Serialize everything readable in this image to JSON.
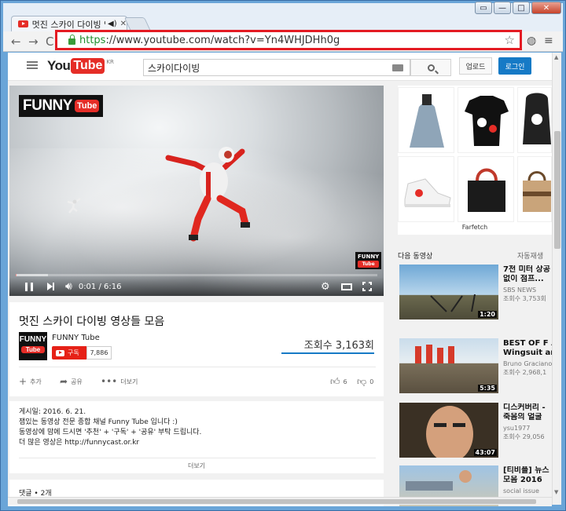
{
  "browser": {
    "tab_title": "멋진 스카이 다이빙 영",
    "url_https": "https",
    "url_rest": "://www.youtube.com/watch?v=Yn4WHJDHh0g"
  },
  "masthead": {
    "logo_you": "You",
    "logo_tube": "Tube",
    "logo_region": "KR",
    "search_value": "스카이다이빙",
    "upload_label": "업로드",
    "login_label": "로그인"
  },
  "player": {
    "badge_funny": "FUNNY",
    "badge_tube": "Tube",
    "watermark_funny": "FUNNY",
    "watermark_tube": "Tube",
    "time": "0:01 / 6:16",
    "progress": 0.003,
    "buffered": 0.09
  },
  "video": {
    "title": "멋진 스카이 다이빙 영상들 모음",
    "channel_name": "FUNNY Tube",
    "channel_logo_funny": "FUNNY",
    "channel_logo_tube": "Tube",
    "subscribe_label": "구독",
    "subscriber_count": "7,886",
    "views": "조회수 3,163회",
    "add_label": "추가",
    "share_label": "공유",
    "more_label": "더보기",
    "likes": "6",
    "dislikes": "0"
  },
  "description": {
    "published": "게시일: 2016. 6. 21.",
    "line1": "잼있는 동영상 전문 종합 채널 Funny Tube 입니다 :)",
    "line2": "동영상에 맘에 드시면 '추천' + '구독' + '공유' 부탁 드립니다.",
    "line3": "더 많은 영상은 http://funnycast.or.kr",
    "more": "더보기"
  },
  "comments": {
    "label": "댓글 • 2개"
  },
  "sidebar": {
    "ad_brand": "Farfetch",
    "up_next": "다음 동영상",
    "autoplay": "자동재생",
    "items": [
      {
        "title1": "7천 미터 상공",
        "title2": "없이 점프...",
        "channel": "SBS NEWS",
        "views": "조회수 3,753회",
        "duration": "1:20"
      },
      {
        "title1": "BEST OF F A",
        "title2": "Wingsuit and",
        "channel": "Bruno Graciano",
        "views": "조회수 2,968,1",
        "duration": "5:35"
      },
      {
        "title1": "디스커버리 -",
        "title2": "죽음의 얼굴",
        "channel": "ysu1977",
        "views": "조회수 29,056",
        "duration": "43:07"
      },
      {
        "title1": "[티비플] 뉴스",
        "title2": "모음 2016",
        "channel": "social issue",
        "views": "",
        "duration": ""
      }
    ]
  },
  "colors": {
    "accent_red": "#e52d27",
    "link_blue": "#167ac6",
    "omnibox_highlight": "#e41b23"
  }
}
